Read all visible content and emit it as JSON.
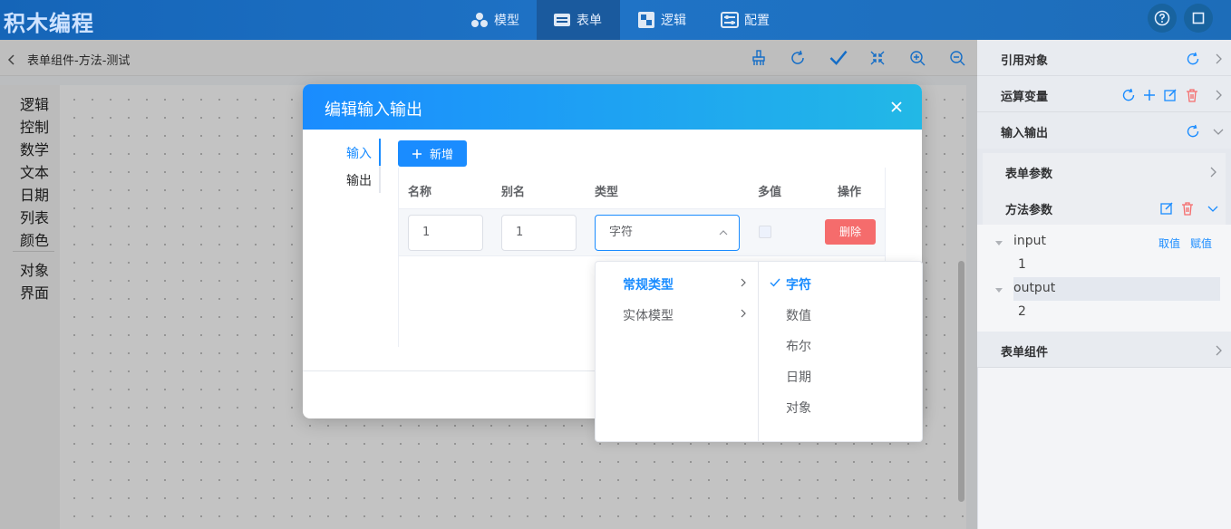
{
  "app": {
    "brand": "积木编程",
    "nav": [
      {
        "label": "模型",
        "icon": "model-icon"
      },
      {
        "label": "表单",
        "icon": "form-icon",
        "active": true
      },
      {
        "label": "逻辑",
        "icon": "logic-icon"
      },
      {
        "label": "配置",
        "icon": "config-icon"
      }
    ],
    "top_icons": [
      "help-icon",
      "window-icon"
    ]
  },
  "toolbar": {
    "breadcrumb": "表单组件-方法-测试",
    "icons": [
      "clean-icon",
      "refresh-icon",
      "check-icon",
      "fit-icon",
      "zoom-in-icon",
      "zoom-out-icon"
    ]
  },
  "palette": {
    "categories": [
      "逻辑",
      "控制",
      "数学",
      "文本",
      "日期",
      "列表",
      "颜色",
      "对象",
      "界面"
    ]
  },
  "modal": {
    "title": "编辑输入输出",
    "tabs": [
      "输入",
      "输出"
    ],
    "add_button": "新增",
    "columns": [
      "名称",
      "别名",
      "类型",
      "多值",
      "操作"
    ],
    "row": {
      "name": "1",
      "alias": "1",
      "type": "字符",
      "delete": "删除"
    }
  },
  "cascader": {
    "level1": [
      "常规类型",
      "实体模型"
    ],
    "level2": [
      "字符",
      "数值",
      "布尔",
      "日期",
      "对象"
    ],
    "selected": "字符"
  },
  "right_panel": {
    "sections": [
      "引用对象",
      "运算变量",
      "输入输出",
      "表单组件"
    ],
    "subsections": [
      "表单参数",
      "方法参数"
    ],
    "tree": {
      "input": "input",
      "input_child": "1",
      "output": "output",
      "output_child": "2",
      "get_value": "取值",
      "set_value": "赋值"
    }
  },
  "colors": {
    "primary": "#1a8cff",
    "danger": "#f56c6c",
    "topbar": "#1f6fbf"
  }
}
